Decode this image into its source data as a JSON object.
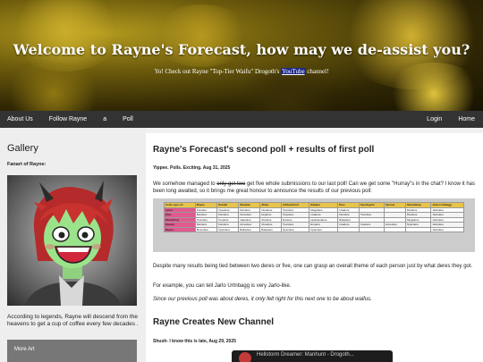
{
  "hero": {
    "title": "Welcome to Rayne's Forecast, how may we de-assist you?",
    "subtitle_before": "Yo!  Check out Rayne \"Top-Tier Waifu\" Drogoth's ",
    "subtitle_link": "YouTube",
    "subtitle_after": " channel!"
  },
  "nav": {
    "left": [
      "About Us",
      "Follow Rayne",
      "a",
      "Poll"
    ],
    "right": [
      "Login",
      "Home"
    ]
  },
  "sidebar": {
    "title": "Gallery",
    "fanart_label": "Fanart of Rayne:",
    "description": "According to legends, Rayne will descend from the heavens to get a cup of coffee every few decades .",
    "more_art": "More Art"
  },
  "post1": {
    "title": "Rayne's Forecast's second poll + results of first poll",
    "meta": "Yippee. Polls. Exciting. Aug 31, 2025",
    "p1_before": "We somehow managed to ",
    "p1_strike": "only get two",
    "p1_after": " get five whole submissions to our last poll! Can we get some \"Hurray\"s in the chat? I know it has been long awaited, so it brings me great honour to announce the results of our previous poll:",
    "p2": "Despite many results being tied between two deres or five, one can grasp an overall theme of each person just by what deres they got.",
    "p3": "For example, you can tell Jarlo Urtnbagg is very Jarlo-like.",
    "p4": "Since our previous poll was about deres, it only felt right for this next one to be about waifus."
  },
  "poll_table": {
    "header": [
      "In the eyes of:",
      "Rayne",
      "Kamell",
      "Shadow",
      "Aklas",
      "Adthechtroit",
      "Sabaire",
      "Kiev",
      "Sporkyplot",
      "Tyreser",
      "Shrumbtop",
      "Jarlo Urtnbagg"
    ],
    "rows": [
      [
        "Lyera",
        "Kuudere",
        "Oujodere",
        "Dandere",
        "Utsudere",
        "Tsundere",
        "Megadere",
        "Usadere",
        "",
        "",
        "Dandere",
        "Jarlodere"
      ],
      [
        "Kian",
        "Dandere",
        "Dandere",
        "Kamidere",
        "Hujidere",
        "Oujodere",
        "Usadere",
        "Dandere",
        "Tsundere",
        "",
        "Dandere",
        "Jarlodere"
      ],
      [
        "Sheepfrog",
        "Tsundere",
        "Kuudere",
        "Jadedere",
        "Ahodere",
        "Erodere",
        "Hiyakasudere",
        "Bakadere",
        "",
        "",
        "Megadere",
        "Jarlodere"
      ],
      [
        "Kavarit",
        "Dandere",
        "Dandere",
        "Himedere",
        "Utsudere",
        "Tsundere",
        "Erodere",
        "Usadere",
        "Usadere",
        "Himedere",
        "Nyandere",
        "Jarlodere"
      ],
      [
        "Rayne",
        "Mesodere",
        "Nyandere",
        "Bakadere",
        "Bakadere",
        "Nyandere",
        "Nyandere",
        "",
        "",
        "",
        "",
        "Jarlodere"
      ]
    ]
  },
  "post2": {
    "title": "Rayne Creates New Channel",
    "meta": "Shush- I know this is late, Aug 29, 2025",
    "video_title": "Hellstorm Dreamer: Manhunt - Drogoth..."
  },
  "colors": {
    "nav_bg": "#333333",
    "sidebar_bg": "#eeeeee",
    "poll_header": "#e8c44a",
    "poll_name": "#e25a8f",
    "link_highlight": "#1d2a8c"
  }
}
